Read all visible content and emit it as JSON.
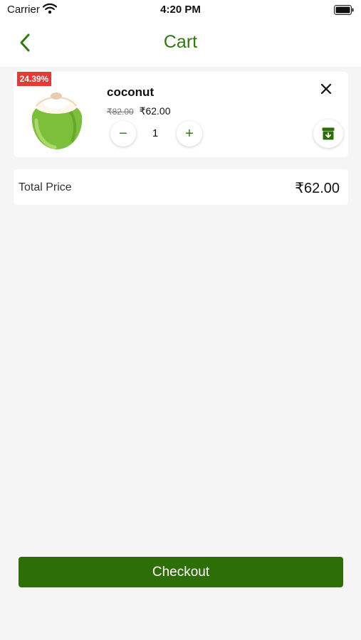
{
  "status_bar": {
    "carrier": "Carrier",
    "time": "4:20 PM"
  },
  "nav": {
    "title": "Cart",
    "back_icon": "chevron-left-icon"
  },
  "cart_item": {
    "discount": "24.39%",
    "name": "coconut",
    "original_price": "₹82.00",
    "price": "₹62.00",
    "quantity": "1",
    "minus_label": "−",
    "plus_label": "+"
  },
  "summary": {
    "label": "Total Price",
    "value": "₹62.00"
  },
  "checkout": {
    "label": "Checkout"
  },
  "colors": {
    "brand_green": "#2e6e07",
    "title_green": "#2f7a0c",
    "badge_red": "#e53935",
    "background": "#f5f5f5"
  }
}
